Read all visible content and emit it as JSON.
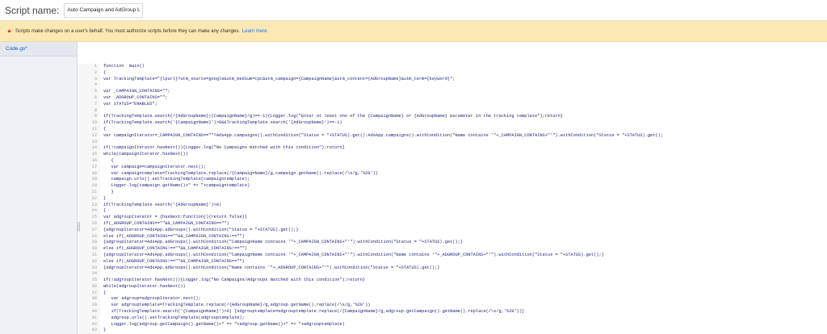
{
  "header": {
    "label": "Script name:",
    "script_name_value": "Auto Campaign and AdGroup L"
  },
  "warning": {
    "message": "Scripts make changes on a user's behalf. You must authorize scripts before they can make any changes.",
    "link": "Learn more"
  },
  "sidebar": {
    "files": [
      "Code.gs*"
    ]
  },
  "code_lines": [
    "function  main()",
    "{",
    "var TrackingTemplate=\"{lpurl}?utm_source=google&utm_medium=cpc&utm_campaign={CampaignName}&utm_content={AdGroupName}&utm_term={keyword}\";",
    "",
    "var _CAMPAIGN_CONTAINS=\"\";",
    "var _ADGROUP_CONTAINS=\"\";",
    "var STATUS=\"ENABLED\";",
    "",
    "if(TrackingTemplate.search(/{AdGroupName}|{CampaignName}/g)==-1){Logger.log(\"Enter at least one of the {CampaignName} or {AdGroupName} parameter in the tracking template\");return}",
    "if(TrackingTemplate.search('{CampaignName}')>0&&TrackingTemplate.search('{AdGroupName}')==-1)",
    "{",
    "var campaignIterator=_CAMPAIGN_CONTAINS==\"\"?AdsApp.campaigns().withCondition(\"Status = \"+STATUS).get():AdsApp.campaigns().withCondition(\"Name contains '\"+_CAMPAIGN_CONTAINS+\"'\").withCondition(\"Status = \"+STATUS).get();",
    "",
    "if(!campaignIterator.hasNext()){Logger.log(\"No Campaigns matched with this condition\");return}",
    "while(campaignIterator.hasNext())",
    "   {",
    "   var campaign=campaignIterator.next();",
    "   var campaigntemplate=TrackingTemplate.replace(/{CampaignName}/g,campaign.getName().replace(/\\s/g,'%20'))",
    "   campaign.urls().setTrackingTemplate(campaigntemplate);",
    "   Logger.log(campaign.getName()+\" => \"+campaigntemplate)",
    "   }",
    "}",
    "if(TrackingTemplate.search('{AdGroupName}')>0)",
    "{",
    "var adgroupIterator = {hasNext:function(){return false}}",
    "if(_ADGROUP_CONTAINS==\"\"&&_CAMPAIGN_CONTAINS==\"\")",
    "{adgroupIterator=AdsApp.adGroups().withCondition(\"Status = \"+STATUS).get();}",
    "else if(_ADGROUP_CONTAINS==\"\"&&_CAMPAIGN_CONTAINS!==\"\")",
    "{adgroupIterator=AdsApp.adGroups().withCondition(\"CampaignName contains '\"+_CAMPAIGN_CONTAINS+\"'\").withCondition(\"Status = \"+STATUS).get();}",
    "else if(_ADGROUP_CONTAINS!==\"\"&&_CAMPAIGN_CONTAINS!==\"\")",
    "{adgroupIterator=AdsApp.adGroups().withCondition(\"CampaignName contains '\"+_CAMPAIGN_CONTAINS+\"'\").withCondition(\"Name contains '\"+_ADGROUP_CONTAINS+\"'\").withCondition(\"Status = \"+STATUS).get();}",
    "else if(_ADGROUP_CONTAINS!==\"\"&&_CAMPAIGN_CONTAINS==\"\")",
    "{adgroupIterator=AdsApp.adGroups().withCondition(\"Name contains '\"+_ADGROUP_CONTAINS+\"'\").withCondition(\"Status = \"+STATUS).get();}",
    "",
    "if(!adgroupIterator.hasNext()){Logger.log(\"No Campaigns/Adgroups matched with this condition\");return}",
    "while(adgroupIterator.hasNext())",
    "{",
    "   var adgroup=adgroupIterator.next();",
    "   var adgrouptemplate=TrackingTemplate.replace(/{AdGroupName}/g,adgroup.getName().replace(/\\s/g,'%20'))",
    "   if(TrackingTemplate.search('{CampaignName}')>0) {adgrouptemplate=adgrouptemplate.replace(/{CampaignName}/g,adgroup.getCampaign().getName().replace(/\\s/g,'%20'))}",
    "   adgroup.urls().setTrackingTemplate(adgrouptemplate);",
    "   Logger.log(adgroup.getCampaign().getName()+\" => \"+adgroup.getName()+\" => \"+adgrouptemplate)",
    "}",
    "}",
    "}"
  ]
}
